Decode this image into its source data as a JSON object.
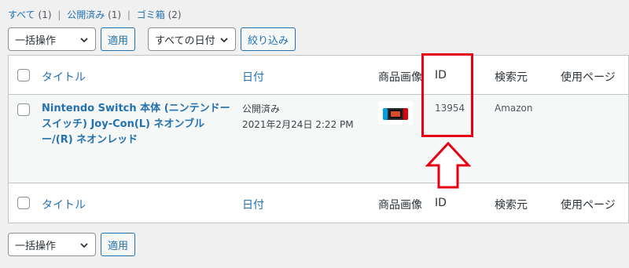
{
  "filters": {
    "all_label": "すべて",
    "all_count": "(1)",
    "published_label": "公開済み",
    "published_count": "(1)",
    "trash_label": "ゴミ箱",
    "trash_count": "(2)",
    "separator": "|"
  },
  "toolbar_top": {
    "bulk_action": "一括操作",
    "apply": "適用",
    "date_filter": "すべての日付",
    "filter_button": "絞り込み"
  },
  "columns": {
    "title": "タイトル",
    "date": "日付",
    "product_image": "商品画像",
    "id": "ID",
    "source": "検索元",
    "used_page": "使用ページ"
  },
  "rows": [
    {
      "title": "Nintendo Switch 本体 (ニンテンドースイッチ) Joy-Con(L) ネオンブルー/(R) ネオンレッド",
      "status": "公開済み",
      "date": "2021年2月24日 2:22 PM",
      "id": "13954",
      "source": "Amazon",
      "used_page": ""
    }
  ],
  "toolbar_bottom": {
    "bulk_action": "一括操作",
    "apply": "適用"
  },
  "colors": {
    "link": "#2271b1",
    "highlight": "#e60012",
    "table_border": "#c3c4c7",
    "row_bg": "#f6f7f7",
    "page_bg": "#f0f0f1"
  },
  "icons": {
    "select_chevron": "chevron-down-icon",
    "callout_arrow": "up-arrow-icon"
  }
}
